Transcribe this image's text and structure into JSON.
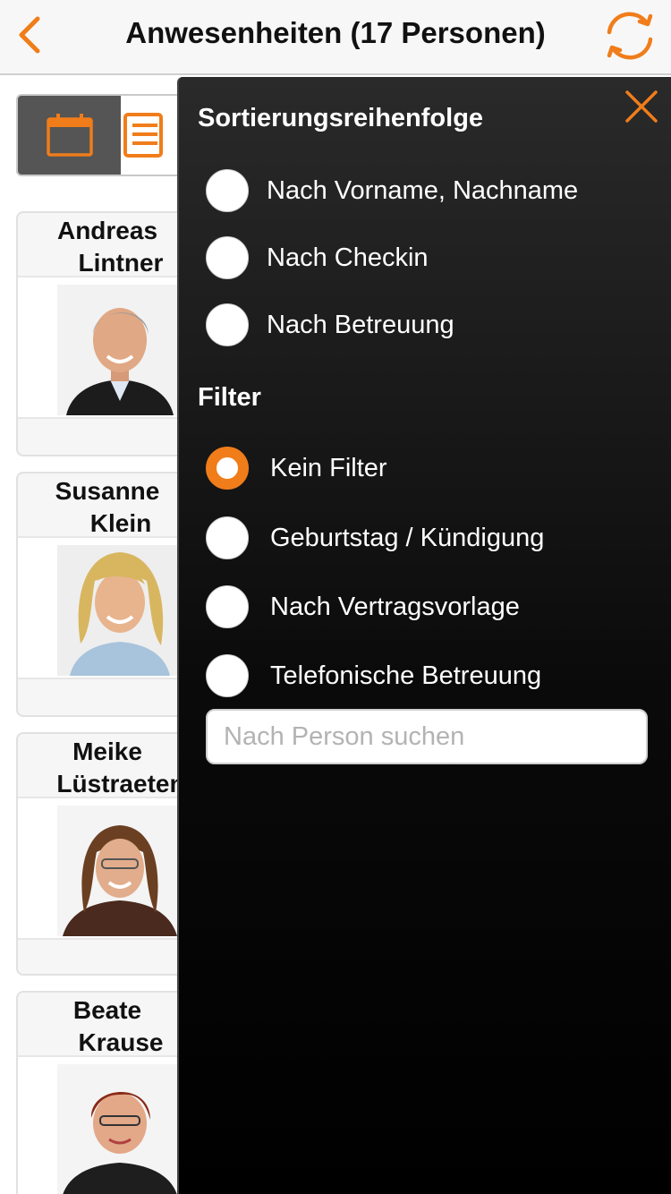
{
  "header": {
    "title": "Anwesenheiten (17 Personen)",
    "back_icon": "chevron-left-icon",
    "sync_icon": "refresh-icon",
    "accent": "#f07d1a"
  },
  "toolbar": {
    "items": [
      {
        "icon": "calendar-icon",
        "active": true
      },
      {
        "icon": "list-icon",
        "active": false
      }
    ]
  },
  "people": [
    {
      "first": "Andreas",
      "last": "Lintner"
    },
    {
      "first": "Susanne",
      "last": "Klein"
    },
    {
      "first": "Meike",
      "last": "Lüstraeten"
    },
    {
      "first": "Beate",
      "last": "Krause"
    }
  ],
  "panel": {
    "close_icon": "close-icon",
    "sort_heading": "Sortierungsreihenfolge",
    "sort_options": [
      {
        "label": "Nach Vorname, Nachname",
        "checked": false
      },
      {
        "label": "Nach Checkin",
        "checked": false
      },
      {
        "label": "Nach Betreuung",
        "checked": false
      }
    ],
    "filter_heading": "Filter",
    "filter_options": [
      {
        "label": "Kein Filter",
        "checked": true
      },
      {
        "label": "Geburtstag / Kündigung",
        "checked": false
      },
      {
        "label": "Nach Vertragsvorlage",
        "checked": false
      },
      {
        "label": "Telefonische Betreuung",
        "checked": false
      }
    ],
    "search": {
      "value": "",
      "placeholder": "Nach Person suchen"
    }
  }
}
